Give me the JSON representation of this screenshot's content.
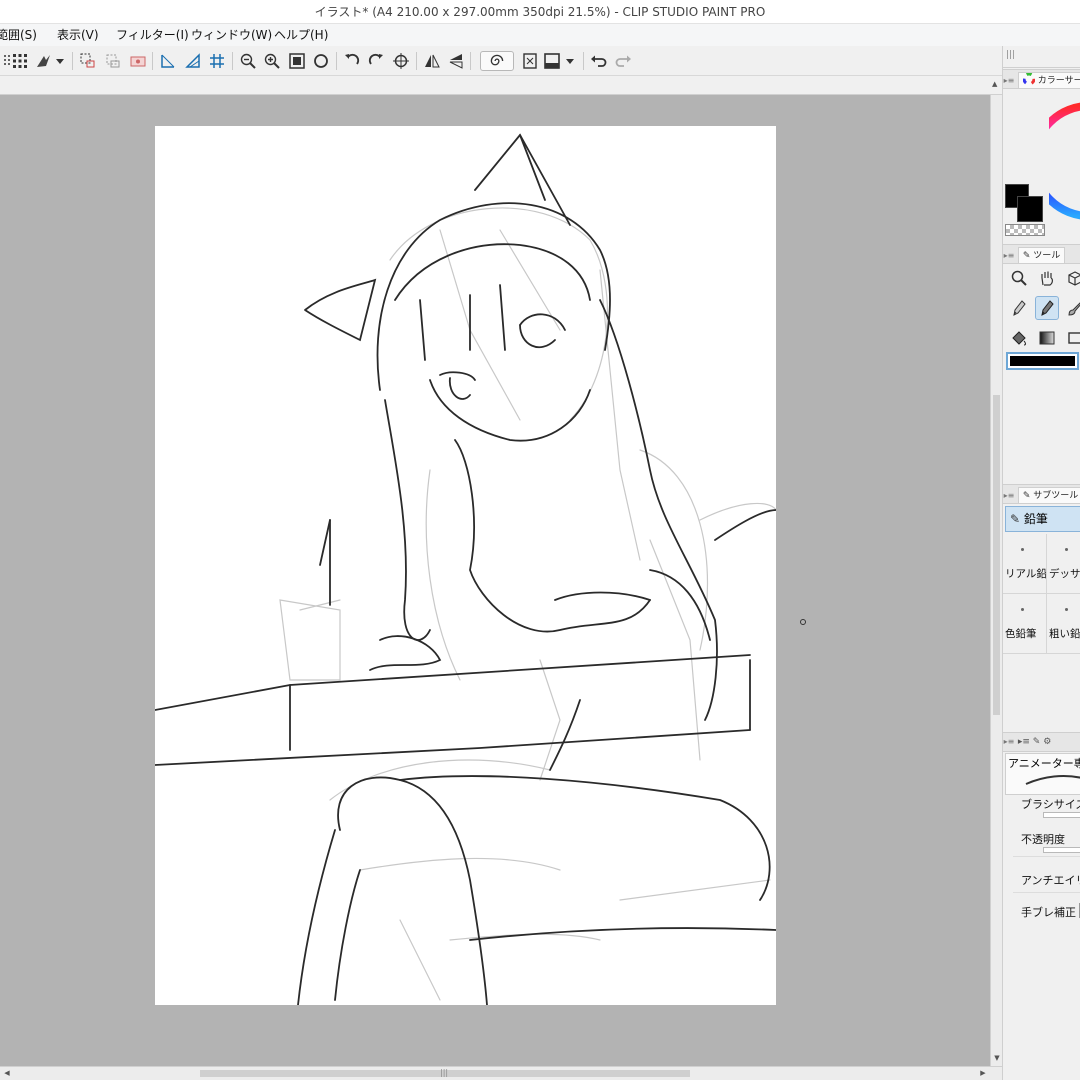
{
  "window": {
    "title": "イラスト* (A4 210.00 x 297.00mm 350dpi 21.5%)  - CLIP STUDIO PAINT PRO"
  },
  "menubar": {
    "items": [
      "範囲(S)",
      "表示(V)",
      "フィルター(I)",
      "ウィンドウ(W)",
      "ヘルプ(H)"
    ]
  },
  "toolbar": {
    "icons": [
      "transform-icon",
      "select-grid-icon",
      "quick-access-icon",
      "selection-icon",
      "clear-outside-icon",
      "clear-selection-icon",
      "ruler-icon",
      "perspective-ruler-icon",
      "grid-icon",
      "zoom-out-icon",
      "zoom-in-icon",
      "fit-screen-icon",
      "actual-size-icon",
      "rotate-left-icon",
      "rotate-right-icon",
      "reset-rotation-icon",
      "flip-horizontal-icon",
      "flip-vertical-icon",
      "stabilizer-icon",
      "snap-icon",
      "screen-mode-icon",
      "undo-icon",
      "redo-icon"
    ]
  },
  "right_panel": {
    "color_circle": {
      "title": "カラーサー",
      "main_color": "#000000",
      "sub_color": "#000000"
    },
    "tool": {
      "title": "ツール",
      "selected_color": "#000000"
    },
    "sub_tool": {
      "title": "サブツール",
      "active_group": "鉛筆",
      "items": [
        {
          "label": "リアル鉛"
        },
        {
          "label": "デッサン"
        },
        {
          "label": "色鉛筆"
        },
        {
          "label": "粗い鉛"
        }
      ]
    },
    "tool_property": {
      "preset_name": "アニメーター専用",
      "rows": [
        {
          "label": "ブラシサイズ"
        },
        {
          "label": "不透明度"
        },
        {
          "label": "アンチエイリア"
        },
        {
          "label": "手ブレ補正"
        }
      ]
    }
  },
  "canvas": {
    "background": "#b3b3b3",
    "paper_color": "#ffffff"
  }
}
